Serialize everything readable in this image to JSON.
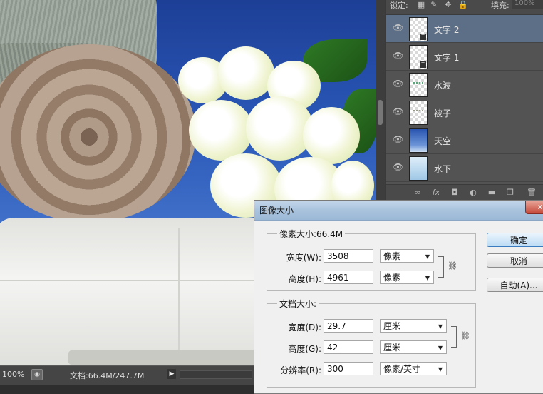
{
  "layers_panel": {
    "lock_label": "锁定:",
    "fill_label": "填充:",
    "fill_value": "100%",
    "layers": [
      {
        "name": "文字 2",
        "type": "text",
        "active": true
      },
      {
        "name": "文字 1",
        "type": "text",
        "active": false
      },
      {
        "name": "水波",
        "type": "pixel",
        "active": false
      },
      {
        "name": "被子",
        "type": "pixel",
        "active": false
      },
      {
        "name": "天空",
        "type": "pixel",
        "active": false
      },
      {
        "name": "水下",
        "type": "pixel",
        "active": false
      }
    ],
    "footer_icons": [
      "link-icon",
      "fx-icon",
      "mask-icon",
      "adjustment-icon",
      "group-folder-icon",
      "new-layer-icon",
      "trash-icon"
    ]
  },
  "status_bar": {
    "zoom": "100%",
    "doc_info": "文档:66.4M/247.7M"
  },
  "dialog": {
    "title": "图像大小",
    "close_label": "x",
    "pixel_group_label": "像素大小:66.4M",
    "width_label": "宽度(W):",
    "width_value": "3508",
    "width_unit": "像素",
    "height_label": "高度(H):",
    "height_value": "4961",
    "height_unit": "像素",
    "doc_group_label": "文档大小:",
    "doc_width_label": "宽度(D):",
    "doc_width_value": "29.7",
    "doc_width_unit": "厘米",
    "doc_height_label": "高度(G):",
    "doc_height_value": "42",
    "doc_height_unit": "厘米",
    "resolution_label": "分辨率(R):",
    "resolution_value": "300",
    "resolution_unit": "像素/英寸",
    "ok_label": "确定",
    "cancel_label": "取消",
    "auto_label": "自动(A)..."
  },
  "colors": {
    "panel_bg": "#535353",
    "active_layer": "#5d6f86",
    "dialog_bg": "#f0f0f0",
    "sky_blue": "#2a58b8"
  }
}
